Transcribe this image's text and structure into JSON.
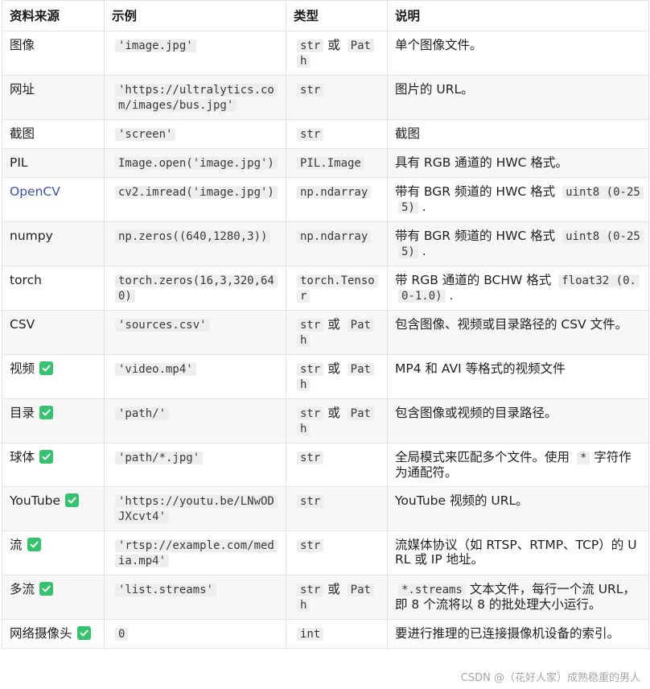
{
  "table": {
    "headers": [
      "资料来源",
      "示例",
      "类型",
      "说明"
    ],
    "rows": [
      {
        "source": "图像",
        "check": false,
        "link": false,
        "example": "'image.jpg'",
        "type_code": "str",
        "type_suffix": " 或 ",
        "type_code2": "Path",
        "desc_parts": [
          {
            "t": "text",
            "v": "单个图像文件。"
          }
        ]
      },
      {
        "source": "网址",
        "check": false,
        "link": false,
        "example": "'https://ultralytics.com/images/bus.jpg'",
        "type_code": "str",
        "type_suffix": "",
        "type_code2": "",
        "desc_parts": [
          {
            "t": "text",
            "v": "图片的 URL。"
          }
        ]
      },
      {
        "source": "截图",
        "check": false,
        "link": false,
        "example": "'screen'",
        "type_code": "str",
        "type_suffix": "",
        "type_code2": "",
        "desc_parts": [
          {
            "t": "text",
            "v": "截图"
          }
        ]
      },
      {
        "source": "PIL",
        "check": false,
        "link": false,
        "example": "Image.open('image.jpg')",
        "type_code": "PIL.Image",
        "type_suffix": "",
        "type_code2": "",
        "desc_parts": [
          {
            "t": "text",
            "v": "具有 RGB 通道的 HWC 格式。"
          }
        ]
      },
      {
        "source": "OpenCV",
        "check": false,
        "link": true,
        "example": "cv2.imread('image.jpg')",
        "type_code": "np.ndarray",
        "type_suffix": "",
        "type_code2": "",
        "desc_parts": [
          {
            "t": "text",
            "v": "带有 BGR 频道的 HWC 格式 "
          },
          {
            "t": "code",
            "v": "uint8 (0-255)"
          },
          {
            "t": "text",
            "v": " ."
          }
        ]
      },
      {
        "source": "numpy",
        "check": false,
        "link": false,
        "example": "np.zeros((640,1280,3))",
        "type_code": "np.ndarray",
        "type_suffix": "",
        "type_code2": "",
        "desc_parts": [
          {
            "t": "text",
            "v": "带有 BGR 频道的 HWC 格式 "
          },
          {
            "t": "code",
            "v": "uint8 (0-255)"
          },
          {
            "t": "text",
            "v": " ."
          }
        ]
      },
      {
        "source": "torch",
        "check": false,
        "link": false,
        "example": "torch.zeros(16,3,320,640)",
        "type_code": "torch.Tensor",
        "type_suffix": "",
        "type_code2": "",
        "desc_parts": [
          {
            "t": "text",
            "v": "带 RGB 通道的 BCHW 格式 "
          },
          {
            "t": "code",
            "v": "float32 (0.0-1.0)"
          },
          {
            "t": "text",
            "v": " ."
          }
        ]
      },
      {
        "source": "CSV",
        "check": false,
        "link": false,
        "example": "'sources.csv'",
        "type_code": "str",
        "type_suffix": " 或 ",
        "type_code2": "Path",
        "desc_parts": [
          {
            "t": "text",
            "v": "包含图像、视频或目录路径的 CSV 文件。"
          }
        ]
      },
      {
        "source": "视频",
        "check": true,
        "link": false,
        "example": "'video.mp4'",
        "type_code": "str",
        "type_suffix": " 或 ",
        "type_code2": "Path",
        "desc_parts": [
          {
            "t": "text",
            "v": "MP4 和 AVI 等格式的视频文件"
          }
        ]
      },
      {
        "source": "目录",
        "check": true,
        "link": false,
        "example": "'path/'",
        "type_code": "str",
        "type_suffix": " 或 ",
        "type_code2": "Path",
        "desc_parts": [
          {
            "t": "text",
            "v": "包含图像或视频的目录路径。"
          }
        ]
      },
      {
        "source": "球体",
        "check": true,
        "link": false,
        "example": "'path/*.jpg'",
        "type_code": "str",
        "type_suffix": "",
        "type_code2": "",
        "desc_parts": [
          {
            "t": "text",
            "v": "全局模式来匹配多个文件。使用 "
          },
          {
            "t": "code",
            "v": "*"
          },
          {
            "t": "text",
            "v": " 字符作为通配符。"
          }
        ]
      },
      {
        "source": "YouTube",
        "check": true,
        "link": false,
        "example": "'https://youtu.be/LNwODJXcvt4'",
        "type_code": "str",
        "type_suffix": "",
        "type_code2": "",
        "desc_parts": [
          {
            "t": "text",
            "v": "YouTube 视频的 URL。"
          }
        ]
      },
      {
        "source": "流",
        "check": true,
        "link": false,
        "example": "'rtsp://example.com/media.mp4'",
        "type_code": "str",
        "type_suffix": "",
        "type_code2": "",
        "desc_parts": [
          {
            "t": "text",
            "v": "流媒体协议（如 RTSP、RTMP、TCP）的 URL 或 IP 地址。"
          }
        ]
      },
      {
        "source": "多流",
        "check": true,
        "link": false,
        "example": "'list.streams'",
        "type_code": "str",
        "type_suffix": " 或 ",
        "type_code2": "Path",
        "desc_parts": [
          {
            "t": "code",
            "v": "*.streams"
          },
          {
            "t": "text",
            "v": " 文本文件，每行一个流 URL，即 8 个流将以 8 的批处理大小运行。"
          }
        ]
      },
      {
        "source": "网络摄像头",
        "check": true,
        "link": false,
        "example": "0",
        "type_code": "int",
        "type_suffix": "",
        "type_code2": "",
        "desc_parts": [
          {
            "t": "text",
            "v": "要进行推理的已连接摄像机设备的索引。"
          }
        ]
      }
    ]
  },
  "watermark": "CSDN @（花好人家）成熟稳重的男人",
  "colors": {
    "link": "#3b4fb8",
    "check": "#35c46d",
    "code_bg": "#eeeeee",
    "border": "#e3e3e3"
  },
  "icons": {
    "check": "check-icon"
  }
}
